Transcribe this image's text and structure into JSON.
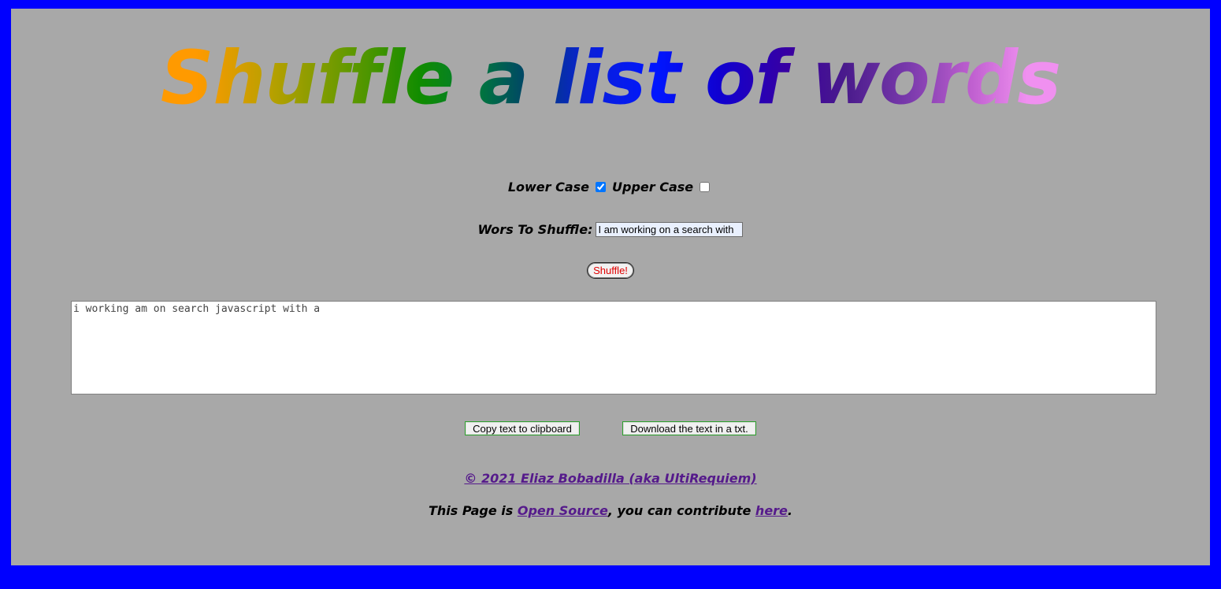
{
  "header": {
    "title": "Shuffle a list of words"
  },
  "options": {
    "lower_case_label": "Lower Case",
    "lower_case_checked": true,
    "upper_case_label": "Upper Case",
    "upper_case_checked": false
  },
  "input": {
    "label": "Wors To Shuffle:",
    "value": "I am working on a search with"
  },
  "shuffle_button": {
    "label": "Shuffle!"
  },
  "output": {
    "text": "i working am on search javascript with a"
  },
  "actions": {
    "copy_label": "Copy text to clipboard",
    "download_label": "Download the text in a txt."
  },
  "footer": {
    "copyright": "© 2021 Eliaz Bobadilla (aka UltiRequiem)",
    "open_prefix": "This Page is ",
    "open_link": "Open Source",
    "open_middle": ", you can contribute ",
    "here_link": "here",
    "open_suffix": "."
  },
  "colors": {
    "frame": "#0000ff",
    "page_background": "#a8a8a8",
    "link": "#551a8b",
    "shuffle_text": "#e00000",
    "button_border": "#2ea12e"
  }
}
